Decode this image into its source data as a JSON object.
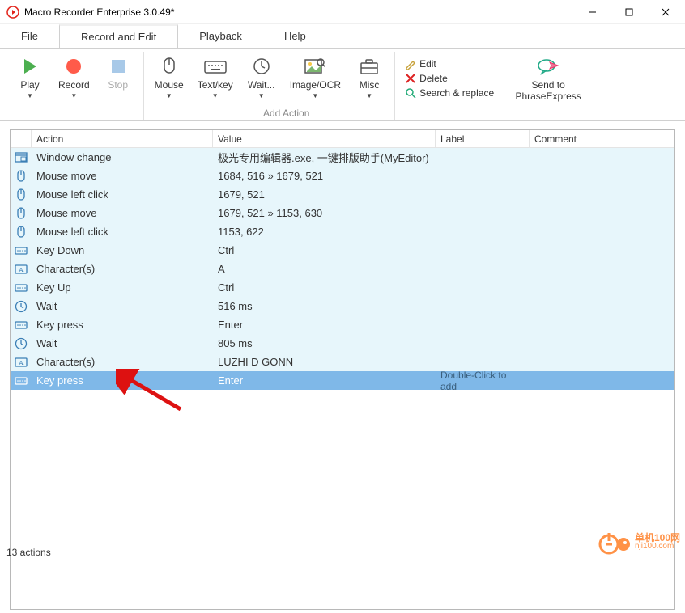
{
  "window": {
    "title": "Macro Recorder Enterprise 3.0.49*"
  },
  "menu": {
    "file": "File",
    "record_edit": "Record and Edit",
    "playback": "Playback",
    "help": "Help"
  },
  "toolbar": {
    "play": "Play",
    "record": "Record",
    "stop": "Stop",
    "mouse": "Mouse",
    "textkey": "Text/key",
    "wait": "Wait...",
    "imageocr": "Image/OCR",
    "misc": "Misc",
    "edit": "Edit",
    "delete": "Delete",
    "search_replace": "Search & replace",
    "sendto1": "Send to",
    "sendto2": "PhraseExpress",
    "add_action_group": "Add Action"
  },
  "table": {
    "headers": {
      "action": "Action",
      "value": "Value",
      "label": "Label",
      "comment": "Comment"
    },
    "rows": [
      {
        "icon": "window",
        "action": "Window change",
        "value": "极光专用编辑器.exe, 一键排版助手(MyEditor)"
      },
      {
        "icon": "mouse",
        "action": "Mouse move",
        "value": "1684, 516 » 1679, 521"
      },
      {
        "icon": "mouse",
        "action": "Mouse left click",
        "value": "1679, 521"
      },
      {
        "icon": "mouse",
        "action": "Mouse move",
        "value": "1679, 521 » 1153, 630"
      },
      {
        "icon": "mouse",
        "action": "Mouse left click",
        "value": "1153, 622"
      },
      {
        "icon": "key",
        "action": "Key Down",
        "value": "Ctrl"
      },
      {
        "icon": "chars",
        "action": "Character(s)",
        "value": "A"
      },
      {
        "icon": "key",
        "action": "Key Up",
        "value": "Ctrl"
      },
      {
        "icon": "wait",
        "action": "Wait",
        "value": "516 ms"
      },
      {
        "icon": "key",
        "action": "Key press",
        "value": "Enter"
      },
      {
        "icon": "wait",
        "action": "Wait",
        "value": "805 ms"
      },
      {
        "icon": "chars",
        "action": "Character(s)",
        "value": "LUZHI D GONN"
      },
      {
        "icon": "key",
        "action": "Key press",
        "value": "Enter",
        "selected": true,
        "hint": "Double-Click to add"
      }
    ]
  },
  "status": "13 actions",
  "watermark": {
    "line1": "单机100网",
    "line2": "nji100.com"
  }
}
